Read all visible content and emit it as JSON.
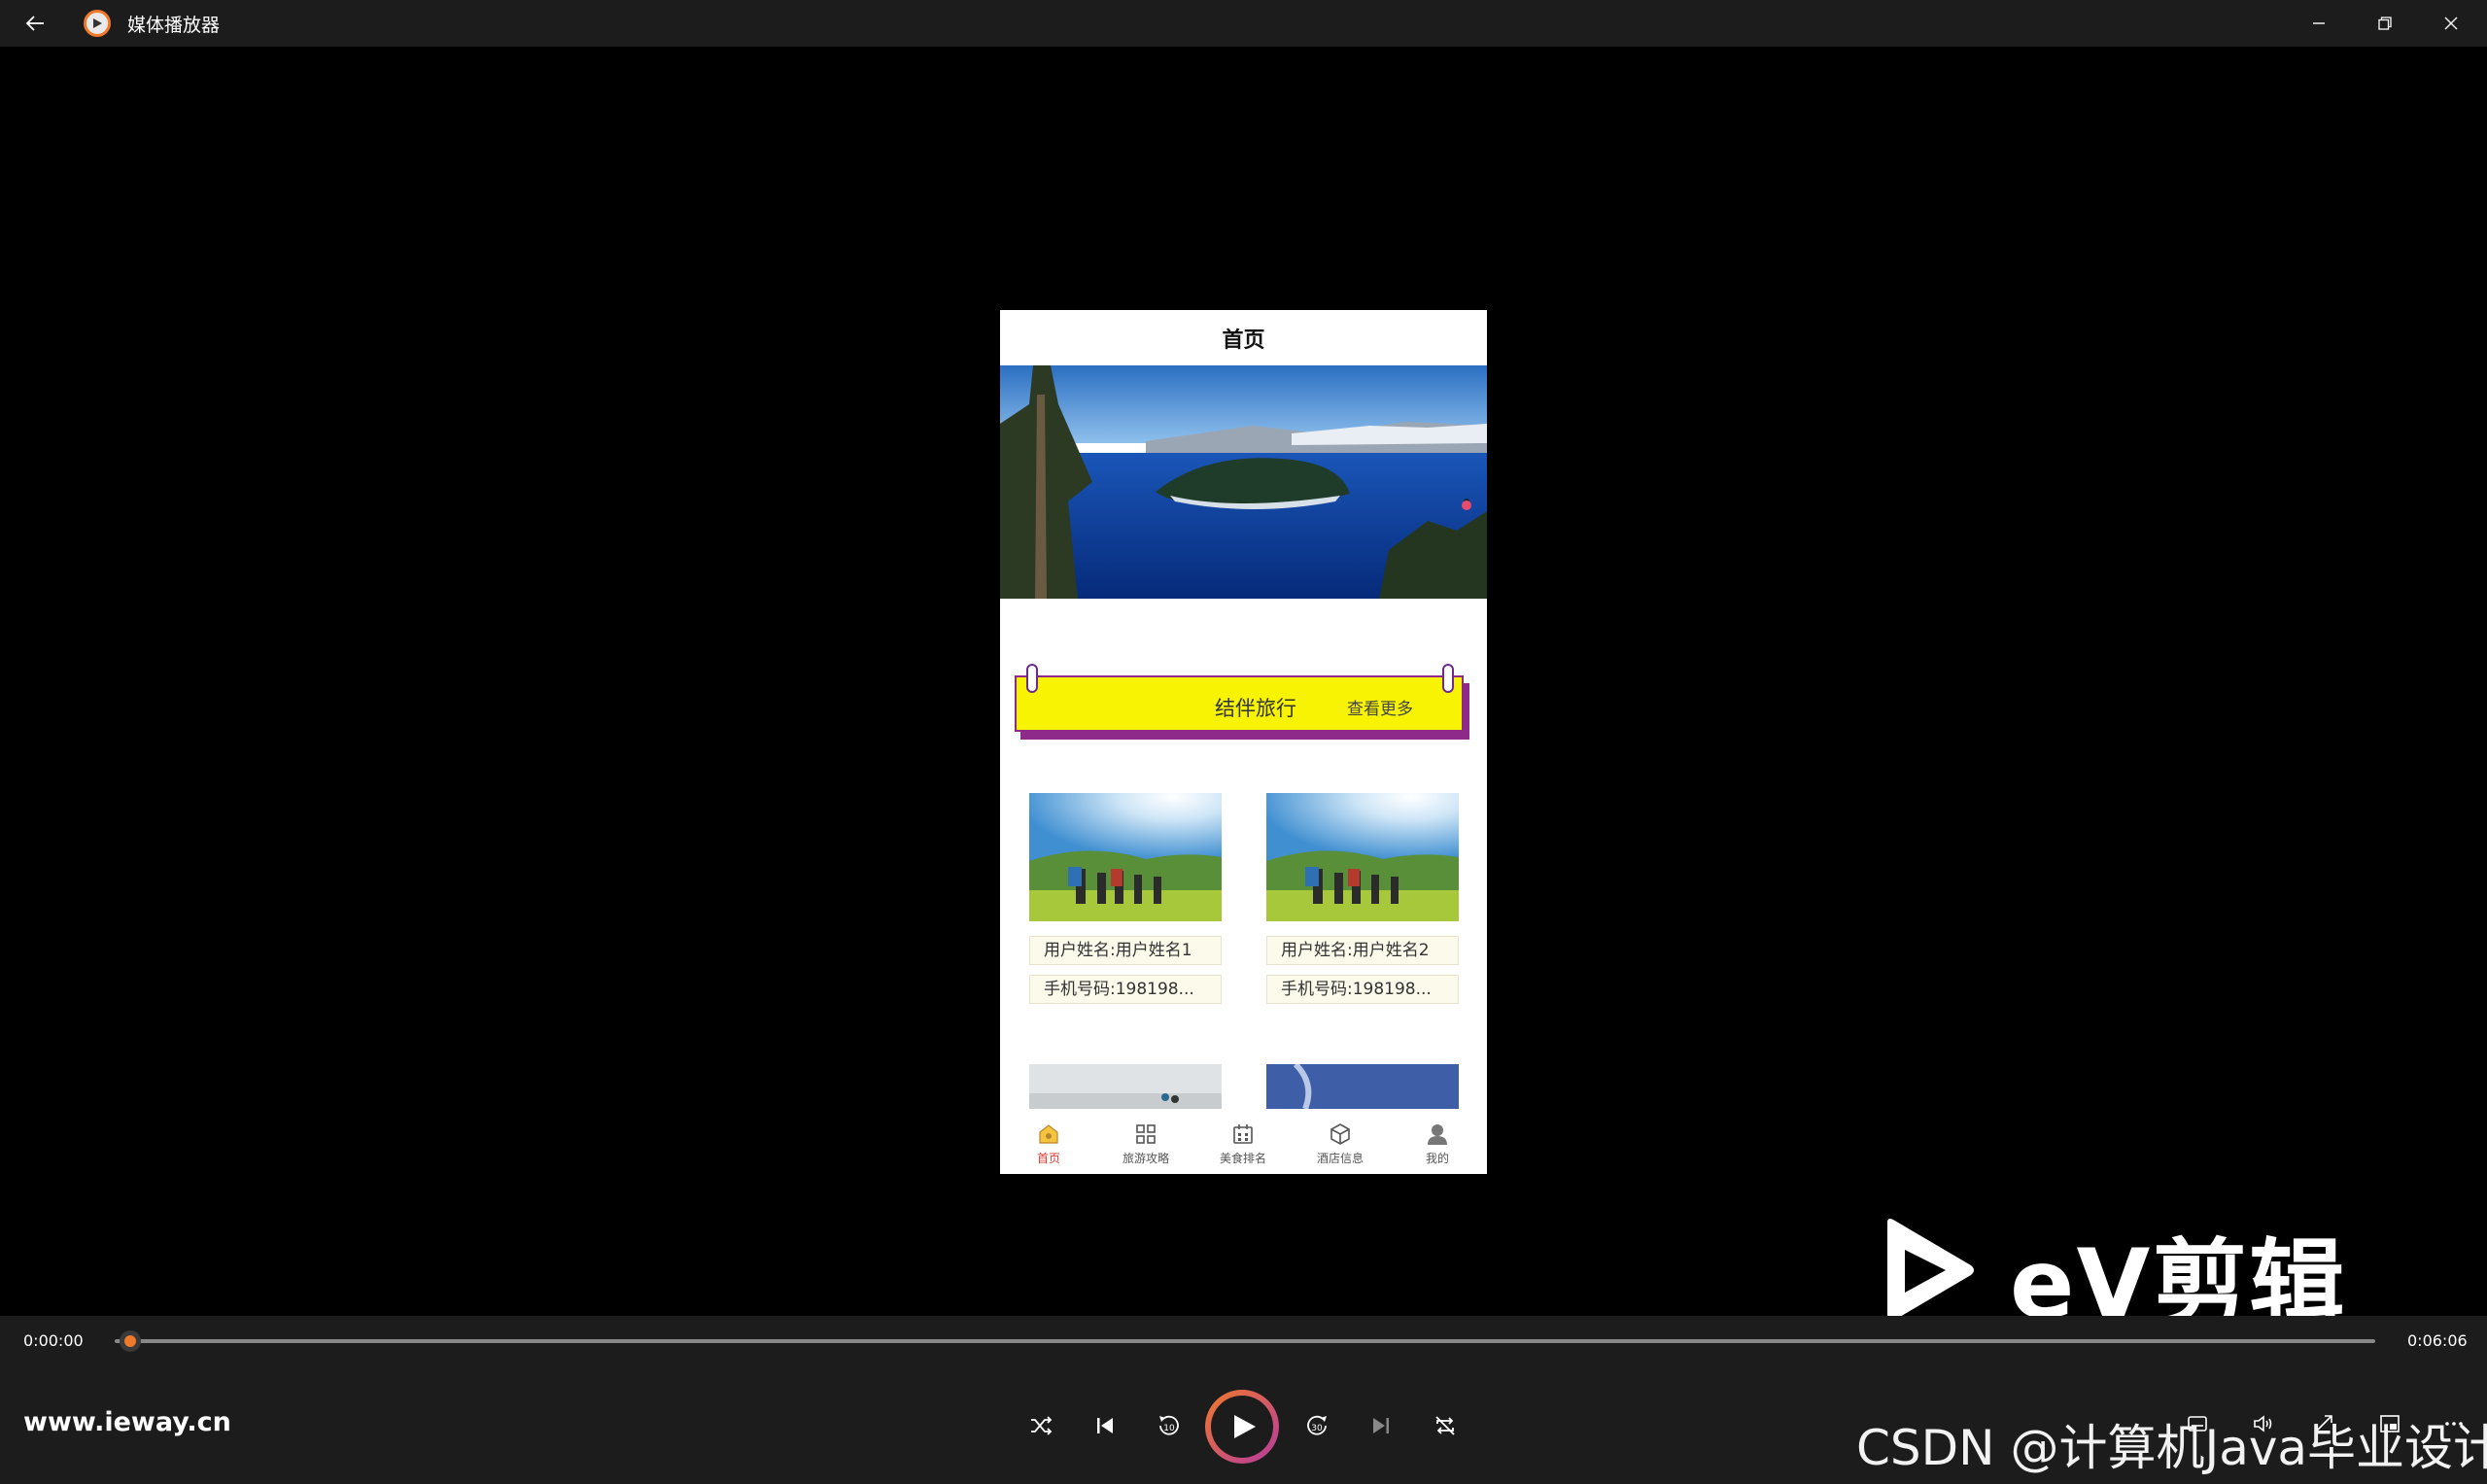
{
  "window": {
    "title": "媒体播放器",
    "icons": [
      "back-arrow-icon",
      "media-player-app-icon",
      "minimize-icon",
      "restore-icon",
      "close-icon"
    ]
  },
  "phone": {
    "header_title": "首页",
    "section": {
      "title": "结伴旅行",
      "more": "查看更多"
    },
    "cards": [
      {
        "name": "用户姓名:用户姓名1",
        "phone": "手机号码:198198..."
      },
      {
        "name": "用户姓名:用户姓名2",
        "phone": "手机号码:198198..."
      }
    ],
    "tabs": [
      {
        "label": "首页",
        "icon": "home-icon",
        "active": true
      },
      {
        "label": "旅游攻略",
        "icon": "grid-icon",
        "active": false
      },
      {
        "label": "美食排名",
        "icon": "calendar-icon",
        "active": false
      },
      {
        "label": "酒店信息",
        "icon": "cube-icon",
        "active": false
      },
      {
        "label": "我的",
        "icon": "user-icon",
        "active": false
      }
    ]
  },
  "watermark": {
    "logo_text": "eV剪辑"
  },
  "player": {
    "time_current": "0:00:00",
    "time_total": "0:06:06",
    "progress": 0.0,
    "url_text": "www.ieway.cn",
    "controls": [
      "shuffle-icon",
      "previous-icon",
      "rewind-10-icon",
      "play-icon",
      "forward-30-icon",
      "next-icon",
      "repeat-off-icon"
    ],
    "right_controls": [
      "subtitles-icon",
      "volume-icon",
      "fullscreen-icon",
      "mini-view-icon",
      "more-icon"
    ],
    "watermark_text": "CSDN @计算机Java毕业设计"
  },
  "colors": {
    "accent": "#f07a2b",
    "section_yellow": "#f7f302",
    "section_border": "#8e2b8a",
    "active_tab": "#e0392e"
  }
}
